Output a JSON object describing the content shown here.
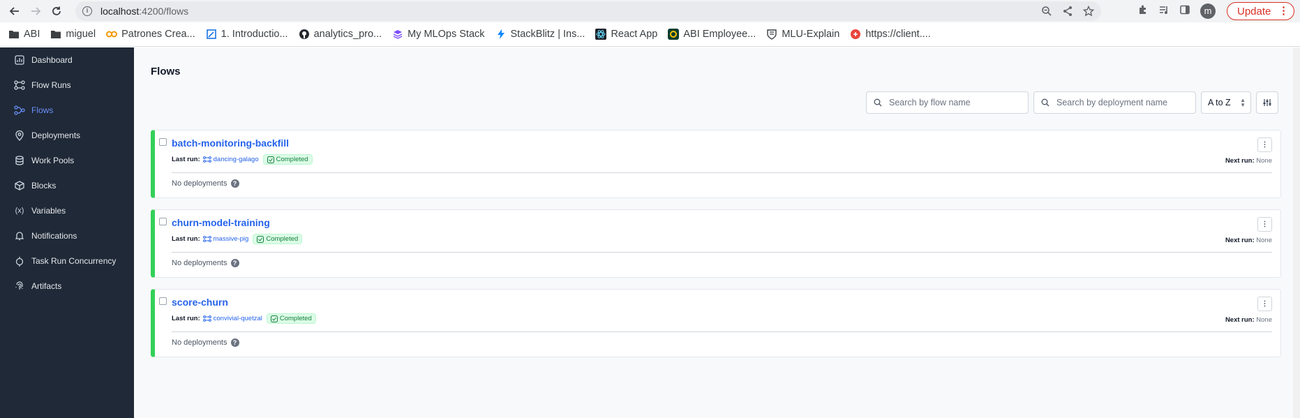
{
  "browser": {
    "url_host": "localhost",
    "url_path": ":4200/flows",
    "avatar_letter": "m",
    "update_label": "Update",
    "bookmarks": [
      {
        "label": "ABI",
        "icon": "folder-icon"
      },
      {
        "label": "miguel",
        "icon": "folder-icon"
      },
      {
        "label": "Patrones Crea...",
        "icon": "patrones-icon"
      },
      {
        "label": "1. Introductio...",
        "icon": "doc-icon"
      },
      {
        "label": "analytics_pro...",
        "icon": "github-icon"
      },
      {
        "label": "My MLOps Stack",
        "icon": "layers-icon"
      },
      {
        "label": "StackBlitz | Ins...",
        "icon": "bolt-icon"
      },
      {
        "label": "React App",
        "icon": "react-icon"
      },
      {
        "label": "ABI Employee...",
        "icon": "abi-icon"
      },
      {
        "label": "MLU-Explain",
        "icon": "shield-icon"
      },
      {
        "label": "https://client....",
        "icon": "client-icon"
      }
    ]
  },
  "sidebar": {
    "items": [
      {
        "label": "Dashboard",
        "icon": "dashboard-icon",
        "active": false
      },
      {
        "label": "Flow Runs",
        "icon": "flow-runs-icon",
        "active": false
      },
      {
        "label": "Flows",
        "icon": "flows-icon",
        "active": true
      },
      {
        "label": "Deployments",
        "icon": "deployments-icon",
        "active": false
      },
      {
        "label": "Work Pools",
        "icon": "work-pools-icon",
        "active": false
      },
      {
        "label": "Blocks",
        "icon": "blocks-icon",
        "active": false
      },
      {
        "label": "Variables",
        "icon": "variables-icon",
        "active": false
      },
      {
        "label": "Notifications",
        "icon": "bell-icon",
        "active": false
      },
      {
        "label": "Task Run Concurrency",
        "icon": "concurrency-icon",
        "active": false
      },
      {
        "label": "Artifacts",
        "icon": "fingerprint-icon",
        "active": false
      }
    ]
  },
  "main": {
    "title": "Flows",
    "search_flow_placeholder": "Search by flow name",
    "search_deployment_placeholder": "Search by deployment name",
    "sort_value": "A to Z",
    "last_run_label": "Last run:",
    "next_run_label": "Next run:",
    "flows": [
      {
        "name": "batch-monitoring-backfill",
        "last_run": "dancing-galago",
        "status": "Completed",
        "next_run": "None",
        "deployments": "No deployments"
      },
      {
        "name": "churn-model-training",
        "last_run": "massive-pig",
        "status": "Completed",
        "next_run": "None",
        "deployments": "No deployments"
      },
      {
        "name": "score-churn",
        "last_run": "convivial-quetzal",
        "status": "Completed",
        "next_run": "None",
        "deployments": "No deployments"
      }
    ]
  },
  "colors": {
    "sidebar_bg": "#1f2937",
    "active_nav": "#6b8ff7",
    "flow_link": "#2563eb",
    "completed_accent": "#34d058",
    "update_red": "#d93025"
  }
}
